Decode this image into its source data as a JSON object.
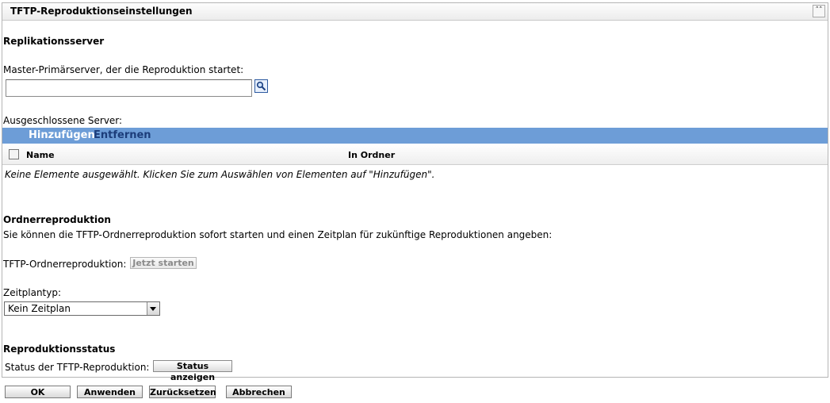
{
  "panel": {
    "title": "TFTP-Reproduktionseinstellungen",
    "collapse_icon": "double-chevron-up-icon"
  },
  "replication": {
    "section_title": "Replikationsserver",
    "master_label": "Master-Primärserver, der die Reproduktion startet:",
    "master_value": "",
    "search_icon": "magnifier-icon",
    "excluded_label": "Ausgeschlossene Server:",
    "toolbar": {
      "add_label": "Hinzufügen",
      "remove_label": "Entfernen"
    },
    "table": {
      "columns": [
        "Name",
        "In Ordner"
      ],
      "empty_message": "Keine Elemente ausgewählt. Klicken Sie zum Auswählen von Elementen auf \"Hinzufügen\"."
    }
  },
  "folder_replication": {
    "section_title": "Ordnerreproduktion",
    "description": "Sie können die TFTP-Ordnerreproduktion sofort starten und einen Zeitplan für zukünftige Reproduktionen angeben:",
    "start_label": "TFTP-Ordnerreproduktion:",
    "start_button": "Jetzt starten",
    "schedule_label": "Zeitplantyp:",
    "schedule_value": "Kein Zeitplan"
  },
  "status": {
    "section_title": "Reproduktionsstatus",
    "label": "Status der TFTP-Reproduktion:",
    "button": "Status anzeigen"
  },
  "footer": {
    "ok": "OK",
    "apply": "Anwenden",
    "reset": "Zurücksetzen",
    "cancel": "Abbrechen"
  },
  "colors": {
    "toolbar_bg": "#6d9dd7",
    "toolbar_add": "#ffffff",
    "toolbar_remove": "#1c3d7a"
  }
}
